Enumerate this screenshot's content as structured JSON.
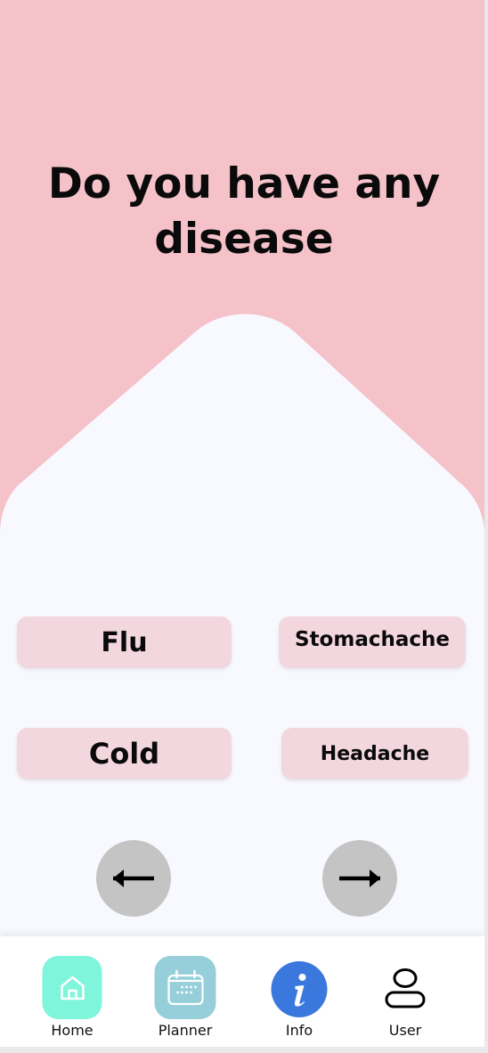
{
  "question": {
    "line1": "Do you have any",
    "line2": "disease"
  },
  "options": {
    "flu": "Flu",
    "stomachache": "Stomachache",
    "cold": "Cold",
    "headache": "Headache"
  },
  "navigation": {
    "back_icon": "arrow-left-icon",
    "next_icon": "arrow-right-icon"
  },
  "tabs": [
    {
      "label": "Home",
      "icon": "home-icon"
    },
    {
      "label": "Planner",
      "icon": "calendar-icon"
    },
    {
      "label": "Info",
      "icon": "info-icon"
    },
    {
      "label": "User",
      "icon": "user-icon"
    }
  ],
  "colors": {
    "header_pink": "#f5c2ca",
    "background": "#f7f9fe",
    "option_pink": "#f3d7de",
    "nav_grey": "#c4c4c4",
    "home_tile": "#7ff5dc",
    "planner_tile": "#96cfd9",
    "info_blue": "#3a78de"
  }
}
